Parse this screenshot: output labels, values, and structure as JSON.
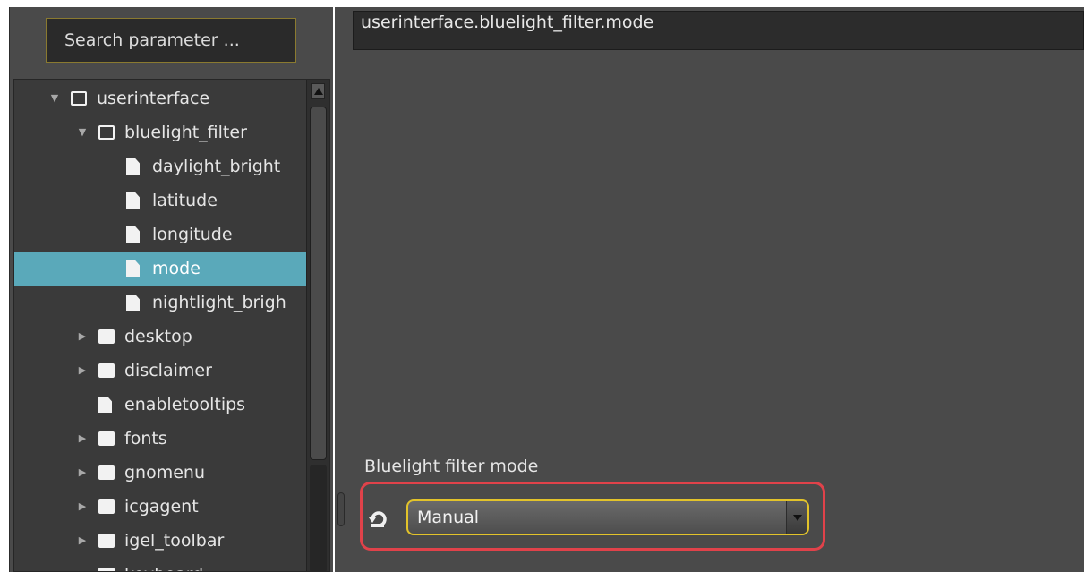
{
  "search": {
    "placeholder_text": "Search parameter ..."
  },
  "tree": {
    "items": [
      {
        "label": "userinterface",
        "icon": "folder-open-icon",
        "expander": "expanded",
        "selected": false
      },
      {
        "label": "bluelight_filter",
        "icon": "folder-open-icon",
        "expander": "expanded",
        "selected": false
      },
      {
        "label": "daylight_bright",
        "icon": "file-icon",
        "expander": "none",
        "selected": false
      },
      {
        "label": "latitude",
        "icon": "file-icon",
        "expander": "none",
        "selected": false
      },
      {
        "label": "longitude",
        "icon": "file-icon",
        "expander": "none",
        "selected": false
      },
      {
        "label": "mode",
        "icon": "file-icon",
        "expander": "none",
        "selected": true
      },
      {
        "label": "nightlight_brigh",
        "icon": "file-icon",
        "expander": "none",
        "selected": false
      },
      {
        "label": "desktop",
        "icon": "folder-closed-icon",
        "expander": "collapsed",
        "selected": false
      },
      {
        "label": "disclaimer",
        "icon": "folder-closed-icon",
        "expander": "collapsed",
        "selected": false
      },
      {
        "label": "enabletooltips",
        "icon": "file-icon",
        "expander": "none",
        "selected": false
      },
      {
        "label": "fonts",
        "icon": "folder-closed-icon",
        "expander": "collapsed",
        "selected": false
      },
      {
        "label": "gnomenu",
        "icon": "folder-closed-icon",
        "expander": "collapsed",
        "selected": false
      },
      {
        "label": "icgagent",
        "icon": "folder-closed-icon",
        "expander": "collapsed",
        "selected": false
      },
      {
        "label": "igel_toolbar",
        "icon": "folder-closed-icon",
        "expander": "collapsed",
        "selected": false
      },
      {
        "label": "keyboard",
        "icon": "folder-closed-icon",
        "expander": "collapsed",
        "selected": false
      }
    ]
  },
  "detail": {
    "parameter_path": "userinterface.bluelight_filter.mode",
    "field_label": "Bluelight filter mode",
    "dropdown_value": "Manual"
  },
  "colors": {
    "selection": "#5aa9ba",
    "highlight_border": "#e0424a",
    "focus_border": "#e2c32a"
  }
}
